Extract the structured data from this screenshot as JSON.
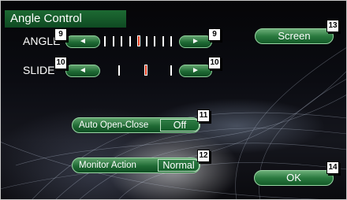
{
  "title": "Angle Control",
  "angle": {
    "label": "ANGLE",
    "left_arrow": "◄",
    "right_arrow": "►",
    "tick_count": 9,
    "active_index": 4,
    "left_badge": "9",
    "right_badge": "9"
  },
  "slide": {
    "label": "SLIDE",
    "left_arrow": "◄",
    "right_arrow": "►",
    "tick_count": 3,
    "active_index": 1,
    "left_badge": "10",
    "right_badge": "10"
  },
  "screen_button": {
    "label": "Screen",
    "badge": "13"
  },
  "auto_open_close": {
    "label": "Auto Open-Close",
    "value": "Off",
    "badge": "11"
  },
  "monitor_action": {
    "label": "Monitor Action",
    "value": "Normal",
    "badge": "12"
  },
  "ok_button": {
    "label": "OK",
    "badge": "14"
  },
  "colors": {
    "accent_green": "#1f6a34",
    "active_tick": "#e23a1c",
    "title_green": "#1d6a33"
  }
}
